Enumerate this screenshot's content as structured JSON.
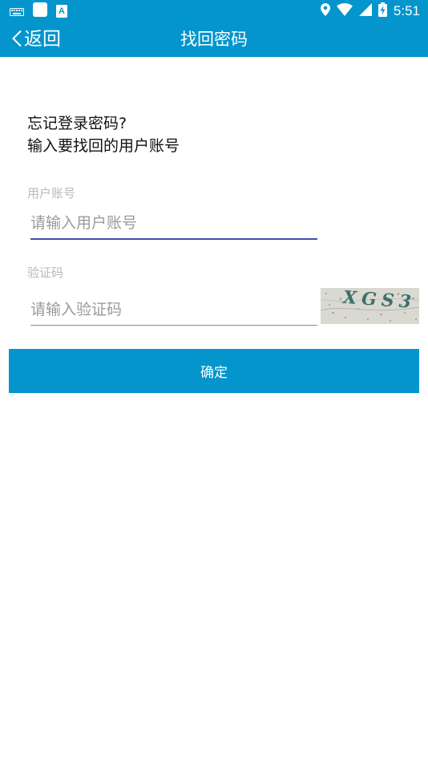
{
  "status_bar": {
    "time": "5:51",
    "icons": [
      "keyboard-icon",
      "app-square-icon",
      "store-a-icon",
      "location-icon",
      "wifi-icon",
      "cell-signal-icon",
      "battery-icon"
    ],
    "store_glyph": "A"
  },
  "header": {
    "back_label": "返回",
    "title": "找回密码"
  },
  "prompt": {
    "line1": "忘记登录密码?",
    "line2": "输入要找回的用户账号"
  },
  "account": {
    "label": "用户账号",
    "placeholder": "请输入用户账号",
    "value": ""
  },
  "captcha": {
    "label": "验证码",
    "placeholder": "请输入验证码",
    "value": "",
    "image_text": "XGS3"
  },
  "confirm_label": "确定",
  "colors": {
    "primary": "#0495cc",
    "focus_underline": "#3f51b5",
    "hint": "#b9b9b9",
    "background": "#ffffff"
  }
}
